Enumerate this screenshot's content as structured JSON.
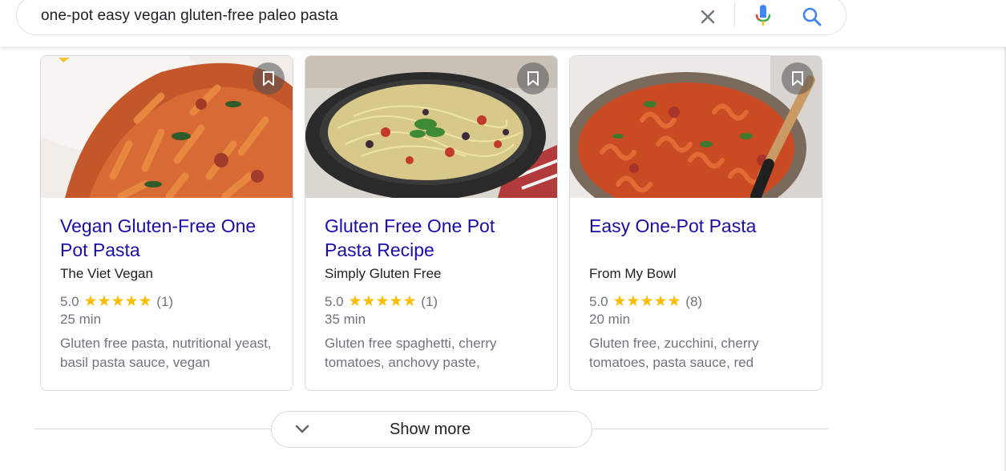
{
  "search": {
    "query": "one-pot easy vegan gluten-free paleo pasta"
  },
  "icons": {
    "clear": "close-icon",
    "mic": "microphone-icon",
    "search": "search-icon",
    "bookmark": "bookmark-icon",
    "expand": "chevron-down-icon"
  },
  "colors": {
    "link": "#1a0dab",
    "star": "#fbbc04",
    "meta": "#70757a",
    "search_blue": "#4285f4"
  },
  "recipes": [
    {
      "title": "Vegan Gluten-Free One Pot Pasta",
      "source": "The Viet Vegan",
      "rating": "5.0",
      "stars": "★★★★★",
      "reviews": "(1)",
      "time": "25 min",
      "ingredients": "Gluten free pasta, nutritional yeast, basil pasta sauce, vegan"
    },
    {
      "title": "Gluten Free One Pot Pasta Recipe",
      "source": "Simply Gluten Free",
      "rating": "5.0",
      "stars": "★★★★★",
      "reviews": "(1)",
      "time": "35 min",
      "ingredients": "Gluten free spaghetti, cherry tomatoes, anchovy paste,"
    },
    {
      "title": "Easy One-Pot Pasta",
      "source": "From My Bowl",
      "rating": "5.0",
      "stars": "★★★★★",
      "reviews": "(8)",
      "time": "20 min",
      "ingredients": "Gluten free, zucchini, cherry tomatoes, pasta sauce, red"
    }
  ],
  "show_more": {
    "label": "Show more"
  }
}
